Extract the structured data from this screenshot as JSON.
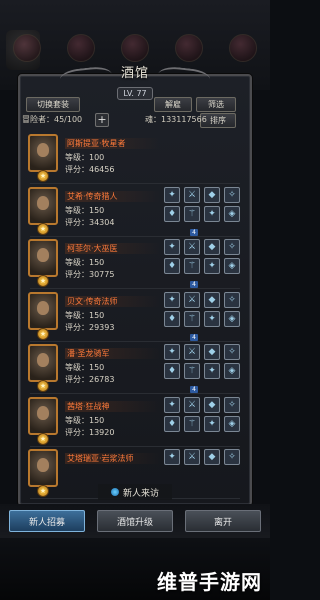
{
  "window": {
    "title": "酒馆",
    "level": "LV. 77"
  },
  "toolbar": {
    "switch_set": "切换套装",
    "dismiss": "解雇",
    "filter": "筛选",
    "sort": "排序"
  },
  "info": {
    "adventurer_count": "冒险者：45/100",
    "add": "+",
    "soul": "魂：133117566"
  },
  "adventurers": [
    {
      "name": "阿斯提亚·牧星者",
      "level": "等级：100",
      "score": "评分：46456",
      "equipment": []
    },
    {
      "name": "艾希·传奇猎人",
      "level": "等级：150",
      "score": "评分：34304",
      "equipment": [
        "✦",
        "⚔",
        "◆",
        "✧",
        "♦",
        "⚚",
        "✦",
        "◈"
      ],
      "badge": "4"
    },
    {
      "name": "柯菲尔·大巫医",
      "level": "等级：150",
      "score": "评分：30775",
      "equipment": [
        "✦",
        "⚔",
        "◆",
        "✧",
        "♦",
        "⚚",
        "✦",
        "◈"
      ],
      "badge": "4"
    },
    {
      "name": "贝文·传奇法师",
      "level": "等级：150",
      "score": "评分：29393",
      "equipment": [
        "✦",
        "⚔",
        "◆",
        "✧",
        "♦",
        "⚚",
        "✦",
        "◈"
      ],
      "badge": "4"
    },
    {
      "name": "潘·圣龙骑军",
      "level": "等级：150",
      "score": "评分：26783",
      "equipment": [
        "✦",
        "⚔",
        "◆",
        "✧",
        "♦",
        "⚚",
        "✦",
        "◈"
      ],
      "badge": "4"
    },
    {
      "name": "茜塔·狂战神",
      "level": "等级：150",
      "score": "评分：13920",
      "equipment": [
        "✦",
        "⚔",
        "◆",
        "✧",
        "♦",
        "⚚",
        "✦",
        "◈"
      ],
      "badge": ""
    },
    {
      "name": "艾塔瑞亚·岩浆法师",
      "level": "",
      "score": "",
      "equipment": [
        "✦",
        "⚔",
        "◆",
        "✧"
      ],
      "badge": ""
    }
  ],
  "visitor": {
    "label": "新人来访"
  },
  "bottom": {
    "recruit": "新人招募",
    "upgrade": "酒馆升级",
    "leave": "离开"
  },
  "watermark": "维普手游网",
  "colors": {
    "name_color": "#ff7a3a",
    "active_button": "#3d6f9a",
    "frame": "#b8782e"
  }
}
